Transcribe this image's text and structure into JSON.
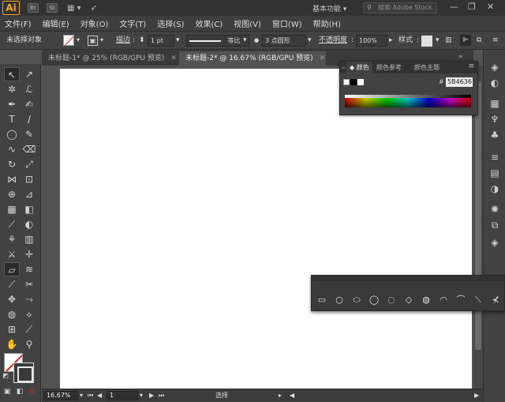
{
  "app": {
    "logo": "Ai",
    "titlebar_chips": [
      "Br",
      "St"
    ],
    "workspace": "基本功能",
    "stock_search_placeholder": "搜索 Adobe Stock",
    "window_controls": [
      "—",
      "❐",
      "✕"
    ]
  },
  "menu": [
    "文件(F)",
    "编辑(E)",
    "对象(O)",
    "文字(T)",
    "选择(S)",
    "效果(C)",
    "视图(V)",
    "窗口(W)",
    "帮助(H)"
  ],
  "control": {
    "selection_state": "未选择对象",
    "stroke_label": "描边",
    "stroke_weight": "1 pt",
    "stroke_profile": "等比",
    "brush": "3 点圆形",
    "opacity_label": "不透明度",
    "opacity_value": "100%",
    "style_label": "样式"
  },
  "tabs": [
    {
      "label": "未标题-1* @ 25% (RGB/GPU 预览)",
      "active": false
    },
    {
      "label": "未标题-2* @ 16.67% (RGB/GPU 预览)",
      "active": true
    }
  ],
  "color_panel": {
    "tabs": [
      "颜色",
      "颜色参考",
      "颜色主题"
    ],
    "hex_label": "#",
    "hex_value": "5B4636",
    "menu_icon": "≡"
  },
  "status": {
    "zoom": "16.67%",
    "artboard": "1",
    "tool": "选择"
  },
  "colors": {
    "accent": "#F7A02A",
    "none_slash": "#E02020",
    "ui_bg": "#535353"
  }
}
